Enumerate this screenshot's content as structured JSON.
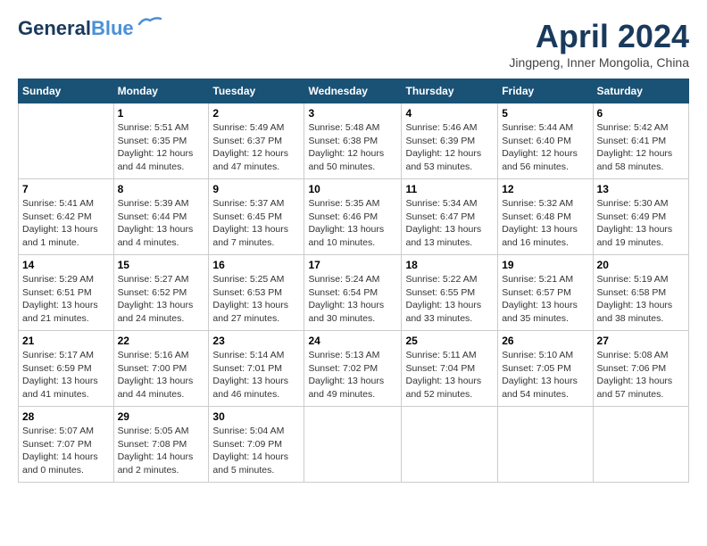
{
  "header": {
    "logo_line1": "General",
    "logo_line2": "Blue",
    "month_title": "April 2024",
    "location": "Jingpeng, Inner Mongolia, China"
  },
  "days_of_week": [
    "Sunday",
    "Monday",
    "Tuesday",
    "Wednesday",
    "Thursday",
    "Friday",
    "Saturday"
  ],
  "weeks": [
    [
      {
        "day": "",
        "info": ""
      },
      {
        "day": "1",
        "info": "Sunrise: 5:51 AM\nSunset: 6:35 PM\nDaylight: 12 hours\nand 44 minutes."
      },
      {
        "day": "2",
        "info": "Sunrise: 5:49 AM\nSunset: 6:37 PM\nDaylight: 12 hours\nand 47 minutes."
      },
      {
        "day": "3",
        "info": "Sunrise: 5:48 AM\nSunset: 6:38 PM\nDaylight: 12 hours\nand 50 minutes."
      },
      {
        "day": "4",
        "info": "Sunrise: 5:46 AM\nSunset: 6:39 PM\nDaylight: 12 hours\nand 53 minutes."
      },
      {
        "day": "5",
        "info": "Sunrise: 5:44 AM\nSunset: 6:40 PM\nDaylight: 12 hours\nand 56 minutes."
      },
      {
        "day": "6",
        "info": "Sunrise: 5:42 AM\nSunset: 6:41 PM\nDaylight: 12 hours\nand 58 minutes."
      }
    ],
    [
      {
        "day": "7",
        "info": "Sunrise: 5:41 AM\nSunset: 6:42 PM\nDaylight: 13 hours\nand 1 minute."
      },
      {
        "day": "8",
        "info": "Sunrise: 5:39 AM\nSunset: 6:44 PM\nDaylight: 13 hours\nand 4 minutes."
      },
      {
        "day": "9",
        "info": "Sunrise: 5:37 AM\nSunset: 6:45 PM\nDaylight: 13 hours\nand 7 minutes."
      },
      {
        "day": "10",
        "info": "Sunrise: 5:35 AM\nSunset: 6:46 PM\nDaylight: 13 hours\nand 10 minutes."
      },
      {
        "day": "11",
        "info": "Sunrise: 5:34 AM\nSunset: 6:47 PM\nDaylight: 13 hours\nand 13 minutes."
      },
      {
        "day": "12",
        "info": "Sunrise: 5:32 AM\nSunset: 6:48 PM\nDaylight: 13 hours\nand 16 minutes."
      },
      {
        "day": "13",
        "info": "Sunrise: 5:30 AM\nSunset: 6:49 PM\nDaylight: 13 hours\nand 19 minutes."
      }
    ],
    [
      {
        "day": "14",
        "info": "Sunrise: 5:29 AM\nSunset: 6:51 PM\nDaylight: 13 hours\nand 21 minutes."
      },
      {
        "day": "15",
        "info": "Sunrise: 5:27 AM\nSunset: 6:52 PM\nDaylight: 13 hours\nand 24 minutes."
      },
      {
        "day": "16",
        "info": "Sunrise: 5:25 AM\nSunset: 6:53 PM\nDaylight: 13 hours\nand 27 minutes."
      },
      {
        "day": "17",
        "info": "Sunrise: 5:24 AM\nSunset: 6:54 PM\nDaylight: 13 hours\nand 30 minutes."
      },
      {
        "day": "18",
        "info": "Sunrise: 5:22 AM\nSunset: 6:55 PM\nDaylight: 13 hours\nand 33 minutes."
      },
      {
        "day": "19",
        "info": "Sunrise: 5:21 AM\nSunset: 6:57 PM\nDaylight: 13 hours\nand 35 minutes."
      },
      {
        "day": "20",
        "info": "Sunrise: 5:19 AM\nSunset: 6:58 PM\nDaylight: 13 hours\nand 38 minutes."
      }
    ],
    [
      {
        "day": "21",
        "info": "Sunrise: 5:17 AM\nSunset: 6:59 PM\nDaylight: 13 hours\nand 41 minutes."
      },
      {
        "day": "22",
        "info": "Sunrise: 5:16 AM\nSunset: 7:00 PM\nDaylight: 13 hours\nand 44 minutes."
      },
      {
        "day": "23",
        "info": "Sunrise: 5:14 AM\nSunset: 7:01 PM\nDaylight: 13 hours\nand 46 minutes."
      },
      {
        "day": "24",
        "info": "Sunrise: 5:13 AM\nSunset: 7:02 PM\nDaylight: 13 hours\nand 49 minutes."
      },
      {
        "day": "25",
        "info": "Sunrise: 5:11 AM\nSunset: 7:04 PM\nDaylight: 13 hours\nand 52 minutes."
      },
      {
        "day": "26",
        "info": "Sunrise: 5:10 AM\nSunset: 7:05 PM\nDaylight: 13 hours\nand 54 minutes."
      },
      {
        "day": "27",
        "info": "Sunrise: 5:08 AM\nSunset: 7:06 PM\nDaylight: 13 hours\nand 57 minutes."
      }
    ],
    [
      {
        "day": "28",
        "info": "Sunrise: 5:07 AM\nSunset: 7:07 PM\nDaylight: 14 hours\nand 0 minutes."
      },
      {
        "day": "29",
        "info": "Sunrise: 5:05 AM\nSunset: 7:08 PM\nDaylight: 14 hours\nand 2 minutes."
      },
      {
        "day": "30",
        "info": "Sunrise: 5:04 AM\nSunset: 7:09 PM\nDaylight: 14 hours\nand 5 minutes."
      },
      {
        "day": "",
        "info": ""
      },
      {
        "day": "",
        "info": ""
      },
      {
        "day": "",
        "info": ""
      },
      {
        "day": "",
        "info": ""
      }
    ]
  ]
}
